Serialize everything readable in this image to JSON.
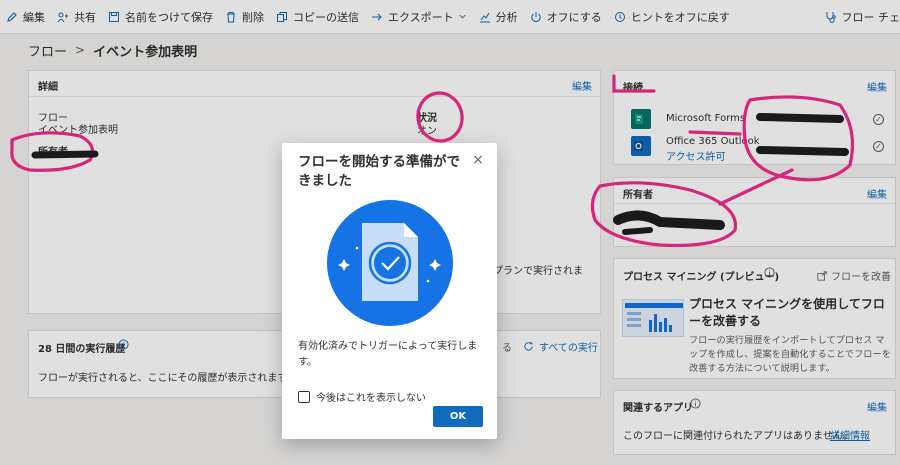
{
  "toolbar": {
    "items": [
      {
        "label": "編集",
        "icon": "pencil-icon"
      },
      {
        "label": "共有",
        "icon": "share-icon"
      },
      {
        "label": "名前をつけて保存",
        "icon": "save-icon"
      },
      {
        "label": "削除",
        "icon": "trash-icon"
      },
      {
        "label": "コピーの送信",
        "icon": "copy-icon"
      },
      {
        "label": "エクスポート",
        "icon": "export-icon"
      },
      {
        "label": "分析",
        "icon": "chart-icon"
      },
      {
        "label": "オフにする",
        "icon": "power-icon"
      },
      {
        "label": "ヒントをオフに戻す",
        "icon": "lightbulb-icon"
      }
    ],
    "right_label": "フロー チェ"
  },
  "breadcrumb": {
    "root": "フロー",
    "current": "イベント参加表明"
  },
  "details": {
    "title": "詳細",
    "edit": "編集",
    "flow_label": "フロー",
    "flow_value": "イベント参加表明",
    "owner_label": "所有者",
    "status_label": "状況",
    "status_value": "オン",
    "plan_text": "のプランで実行されま"
  },
  "history": {
    "title": "28 日間の実行履歴",
    "refresh_fragment": "る",
    "all_runs": "すべての実行",
    "empty_text": "フローが実行されると、ここにその履歴が表示されます。"
  },
  "connections": {
    "title": "接続",
    "edit": "編集",
    "items": [
      {
        "name": "Microsoft Forms",
        "link": ""
      },
      {
        "name": "Office 365 Outlook",
        "link": "アクセス許可"
      }
    ]
  },
  "owners": {
    "title": "所有者",
    "edit": "編集"
  },
  "process_mining": {
    "title": "プロセス マイニング (プレビュー)",
    "improve": "フローを改善",
    "heading": "プロセス マイニングを使用してフローを改善する",
    "body": "フローの実行履歴をインポートしてプロセス マップを作成し、提案を自動化することでフローを改善する方法について説明します。"
  },
  "related_apps": {
    "title": "関連するアプリ",
    "edit": "編集",
    "empty_text": "このフローに関連付けられたアプリはありません。",
    "link": "詳細情報"
  },
  "dialog": {
    "title": "フローを開始する準備ができました",
    "body": "有効化済みでトリガーによって実行します。",
    "checkbox_label": "今後はこれを表示しない",
    "ok": "OK",
    "close": "×"
  },
  "colors": {
    "accent": "#0f6cbd",
    "annotation": "#d6257a",
    "illustration": "#1573e6"
  }
}
